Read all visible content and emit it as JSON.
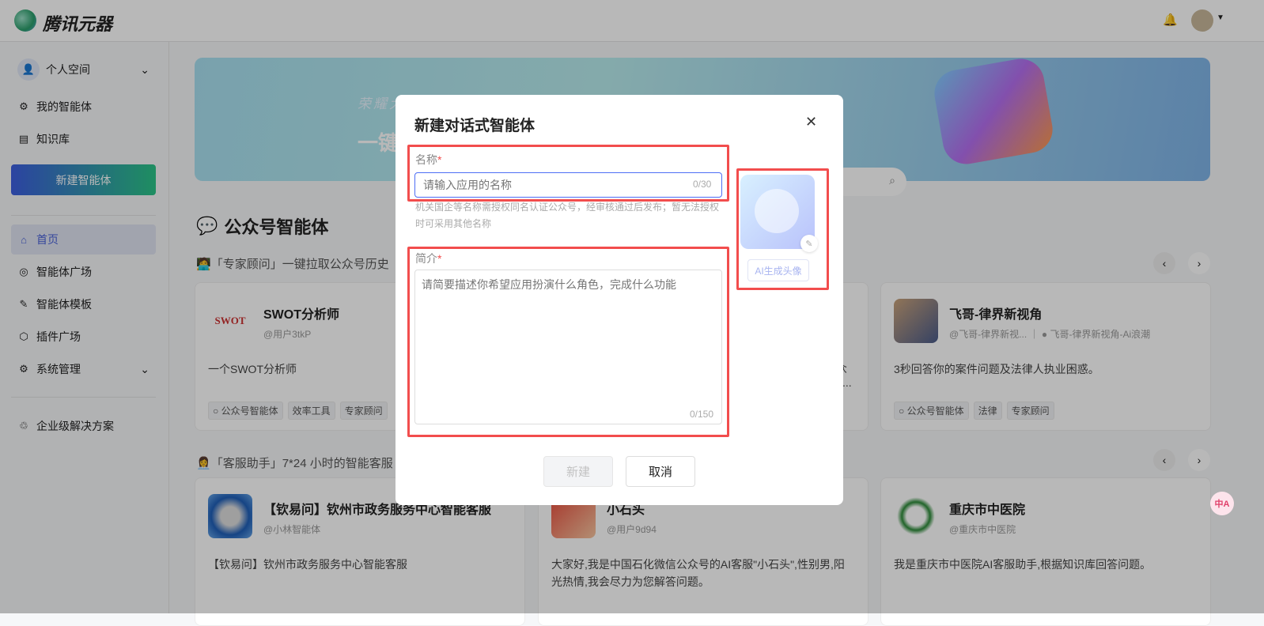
{
  "header": {
    "brand": "腾讯元器",
    "bell_icon": "bell-icon"
  },
  "sidebar": {
    "space": "个人空间",
    "my_agents": "我的智能体",
    "knowledge": "知识库",
    "new_agent": "新建智能体",
    "home": "首页",
    "plaza": "智能体广场",
    "templates": "智能体模板",
    "plugins": "插件广场",
    "system": "系统管理",
    "enterprise": "企业级解决方案"
  },
  "banner": {
    "line1": "荣耀大",
    "line2": "一键"
  },
  "section": {
    "title": "公众号智能体",
    "sub1": "「专家顾问」一键拉取公众号历史",
    "sub2": "「客服助手」7*24 小时的智能客服"
  },
  "cards_row1": [
    {
      "name": "SWOT分析师",
      "author": "@用户3tkP",
      "desc": "一个SWOT分析师",
      "tags": [
        "公众号智能体",
        "效率工具",
        "专家顾问"
      ],
      "logo": "SWOT"
    },
    {
      "name": "飞哥-律界新视角",
      "author": "@飞哥-律界新视...",
      "author2": "飞哥-律界新视角-Ai浪潮",
      "desc": "3秒回答你的案件问题及法律人执业困惑。",
      "tags": [
        "公众号智能体",
        "法律",
        "专家顾问"
      ]
    }
  ],
  "cards_row2": [
    {
      "name": "【钦易问】钦州市政务服务中心智能客服",
      "author": "@小林智能体",
      "desc": "【钦易问】钦州市政务服务中心智能客服"
    },
    {
      "name": "小石头",
      "author": "@用户9d94",
      "desc": "大家好,我是中国石化微信公众号的AI客服\"小石头\",性别男,阳光热情,我会尽力为您解答问题。"
    },
    {
      "name": "重庆市中医院",
      "author": "@重庆市中医院",
      "desc": "我是重庆市中医院AI客服助手,根据知识库回答问题。"
    }
  ],
  "partial": {
    "c2_line1": "众",
    "c2_line2": "..."
  },
  "modal": {
    "title": "新建对话式智能体",
    "name_label": "名称",
    "required": "*",
    "name_placeholder": "请输入应用的名称",
    "name_count": "0/30",
    "name_hint": "机关国企等名称需授权同名认证公众号，经审核通过后发布；暂无法授权时可采用其他名称",
    "intro_label": "简介",
    "intro_placeholder": "请简要描述你希望应用扮演什么角色，完成什么功能",
    "intro_count": "0/150",
    "ai_avatar": "AI生成头像",
    "create": "新建",
    "cancel": "取消"
  },
  "fab": "中A"
}
